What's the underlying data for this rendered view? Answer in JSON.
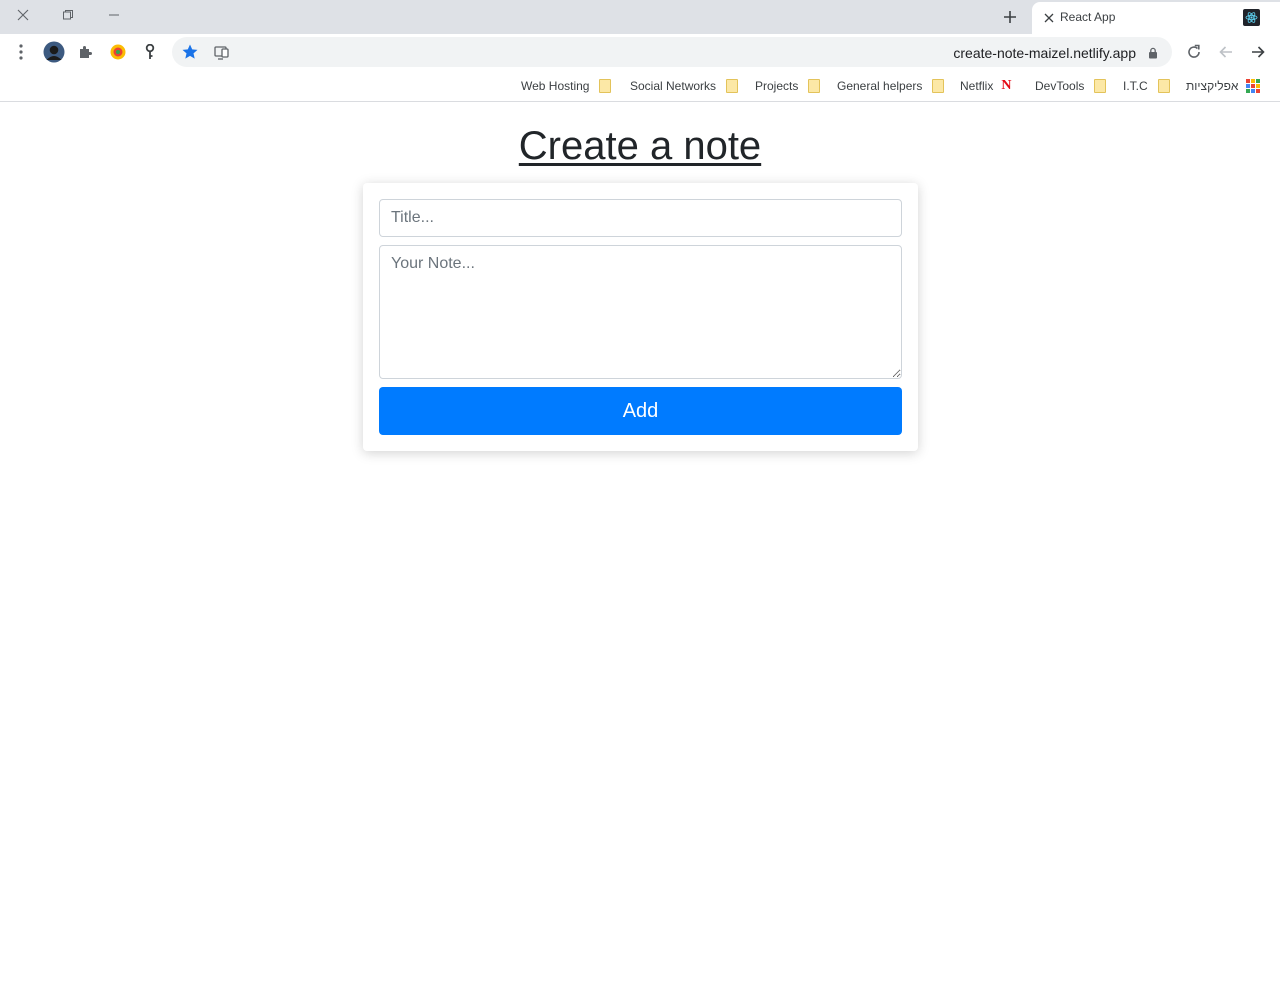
{
  "browser": {
    "tab": {
      "title": "React App"
    },
    "url": "create-note-maizel.netlify.app",
    "bookmarks": [
      {
        "label": "Web Hosting",
        "icon": "folder-icon"
      },
      {
        "label": "Social Networks",
        "icon": "folder-icon"
      },
      {
        "label": "Projects",
        "icon": "folder-icon"
      },
      {
        "label": "General helpers",
        "icon": "folder-icon"
      },
      {
        "label": "Netflix",
        "icon": "netflix-icon"
      },
      {
        "label": "DevTools",
        "icon": "folder-icon"
      },
      {
        "label": "I.T.C",
        "icon": "folder-icon"
      },
      {
        "label": "אפליקציות",
        "icon": "apps-grid-icon"
      }
    ],
    "netflix_glyph": "N"
  },
  "page": {
    "heading": "Create a note",
    "form": {
      "title_placeholder": "Title...",
      "title_value": "",
      "note_placeholder": "Your Note...",
      "note_value": "",
      "add_label": "Add"
    }
  },
  "colors": {
    "primary_button": "#007bff",
    "tab_strip": "#dee1e6",
    "omnibox": "#f1f3f4",
    "star_accent": "#1a73e8"
  }
}
